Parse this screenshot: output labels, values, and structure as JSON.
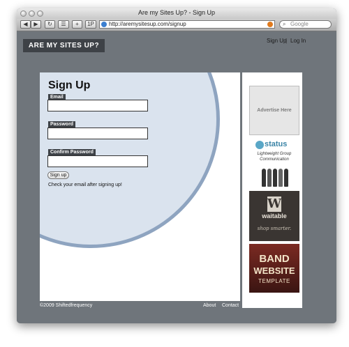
{
  "window": {
    "title": "Are my Sites Up? - Sign Up"
  },
  "toolbar": {
    "back_icon": "back-arrow-icon",
    "forward_icon": "forward-arrow-icon",
    "reload_icon": "reload-icon",
    "add_label": "+",
    "onepassword_label": "1P",
    "url": "http://aremysitesup.com/signup",
    "search_placeholder": "Google"
  },
  "header": {
    "logo": "ARE MY SITES UP?",
    "nav": {
      "signup": "Sign Up",
      "separator": "|",
      "login": "Log In"
    }
  },
  "form": {
    "title": "Sign Up",
    "email_label": "Email",
    "password_label": "Password",
    "confirm_label": "Confirm Password",
    "submit": "Sign up",
    "note": "Check your email after signing up!"
  },
  "ads": {
    "placeholder": "Advertise Here",
    "status_name": "status",
    "status_tagline": "Lightweight Group Communication",
    "waitable_logo": "W",
    "waitable_name": "waitable",
    "waitable_tagline": "shop smarter.",
    "band_line1": "BAND",
    "band_line2": "WEBSITE",
    "band_line3": "TEMPLATE"
  },
  "footer": {
    "copyright": "©2009 Shiftedfrequency",
    "about": "About",
    "contact": "Contact"
  },
  "colors": {
    "page_bg": "#6f757b",
    "circle_fill": "#dae3ee",
    "circle_border": "#8ea4c0",
    "logo_bg": "#3e4247"
  }
}
